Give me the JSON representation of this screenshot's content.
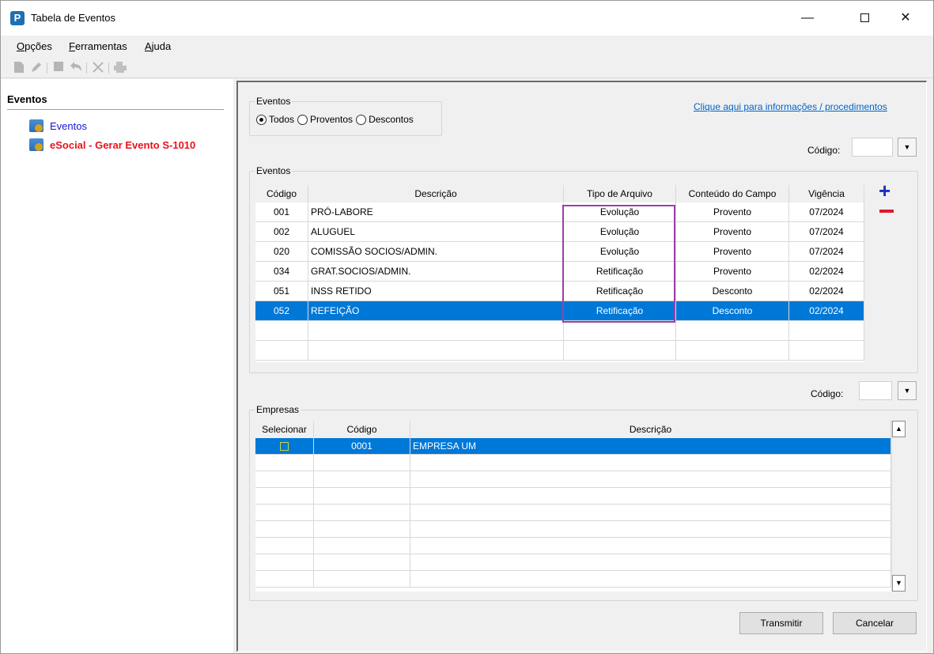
{
  "window": {
    "title": "Tabela de Eventos",
    "app_icon_letter": "P",
    "minimize": "—",
    "close": "✕"
  },
  "menu": {
    "opcoes_first": "O",
    "opcoes_rest": "pções",
    "ferramentas_first": "F",
    "ferramentas_rest": "erramentas",
    "ajuda_first": "A",
    "ajuda_rest": "juda"
  },
  "toolbar": {
    "icons": [
      "new-icon",
      "edit-icon",
      "save-icon",
      "undo-icon",
      "delete-icon",
      "print-icon"
    ]
  },
  "sidebar": {
    "title": "Eventos",
    "items": [
      {
        "label": "Eventos"
      },
      {
        "label": "eSocial - Gerar Evento S-1010"
      }
    ]
  },
  "filter": {
    "legend": "Eventos",
    "options": [
      "Todos",
      "Proventos",
      "Descontos"
    ],
    "selected": "Todos"
  },
  "info_link": "Clique aqui para informações / procedimentos",
  "codigo_label": "Código:",
  "eventos_table": {
    "legend": "Eventos",
    "columns": [
      "Código",
      "Descrição",
      "Tipo de Arquivo",
      "Conteúdo do Campo",
      "Vigência"
    ],
    "rows": [
      {
        "codigo": "001",
        "descricao": "PRÓ-LABORE",
        "tipo": "Evolução",
        "conteudo": "Provento",
        "vigencia": "07/2024"
      },
      {
        "codigo": "002",
        "descricao": "ALUGUEL",
        "tipo": "Evolução",
        "conteudo": "Provento",
        "vigencia": "07/2024"
      },
      {
        "codigo": "020",
        "descricao": "COMISSÃO SOCIOS/ADMIN.",
        "tipo": "Evolução",
        "conteudo": "Provento",
        "vigencia": "07/2024"
      },
      {
        "codigo": "034",
        "descricao": "GRAT.SOCIOS/ADMIN.",
        "tipo": "Retificação",
        "conteudo": "Provento",
        "vigencia": "02/2024"
      },
      {
        "codigo": "051",
        "descricao": "INSS RETIDO",
        "tipo": "Retificação",
        "conteudo": "Desconto",
        "vigencia": "02/2024"
      },
      {
        "codigo": "052",
        "descricao": "REFEIÇÃO",
        "tipo": "Retificação",
        "conteudo": "Desconto",
        "vigencia": "02/2024"
      }
    ],
    "selected_index": 5,
    "add": "+"
  },
  "empresas_table": {
    "legend": "Empresas",
    "columns": [
      "Selecionar",
      "Código",
      "Descrição"
    ],
    "rows": [
      {
        "codigo": "0001",
        "descricao": "EMPRESA UM"
      }
    ]
  },
  "buttons": {
    "transmitir": "Transmitir",
    "cancelar": "Cancelar"
  },
  "colors": {
    "selection": "#0078d7",
    "highlight": "#9b3fa8",
    "link": "#0066cc",
    "sidebar_red": "#e8131d",
    "sidebar_blue": "#1414d8"
  }
}
